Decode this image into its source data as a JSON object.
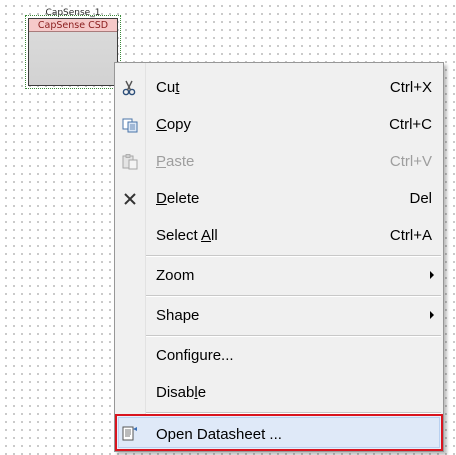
{
  "component": {
    "instance_name": "CapSense_1",
    "title": "CapSense CSD"
  },
  "context_menu": {
    "items": [
      {
        "label": "Cut",
        "shortcut": "Ctrl+X",
        "icon": "scissors-icon",
        "enabled": true,
        "mnemonic": "t"
      },
      {
        "label": "Copy",
        "shortcut": "Ctrl+C",
        "icon": "copy-icon",
        "enabled": true,
        "mnemonic": "C"
      },
      {
        "label": "Paste",
        "shortcut": "Ctrl+V",
        "icon": "paste-icon",
        "enabled": false,
        "mnemonic": "P"
      },
      {
        "label": "Delete",
        "shortcut": "Del",
        "icon": "delete-x-icon",
        "enabled": true,
        "mnemonic": "D"
      },
      {
        "label": "Select All",
        "shortcut": "Ctrl+A",
        "icon": null,
        "enabled": true,
        "mnemonic": "A"
      },
      {
        "label": "Zoom",
        "submenu": true,
        "enabled": true
      },
      {
        "label": "Shape",
        "submenu": true,
        "enabled": true
      },
      {
        "label": "Configure...",
        "enabled": true,
        "mnemonic": "g"
      },
      {
        "label": "Disable",
        "enabled": true,
        "mnemonic": "l"
      },
      {
        "label": "Open Datasheet ...",
        "icon": "datasheet-icon",
        "enabled": true,
        "highlighted": true
      }
    ]
  },
  "colors": {
    "highlight_border": "#d9141e",
    "component_title_bg": "#f6c9c9",
    "menu_bg": "#f0f0f0"
  }
}
